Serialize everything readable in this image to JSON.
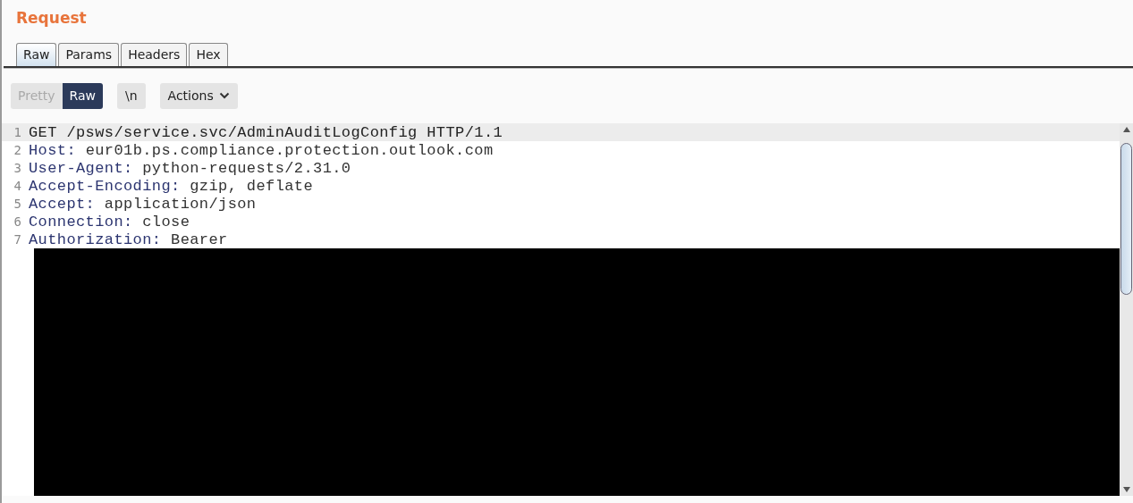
{
  "title": "Request",
  "tabs": [
    {
      "label": "Raw",
      "selected": true
    },
    {
      "label": "Params",
      "selected": false
    },
    {
      "label": "Headers",
      "selected": false
    },
    {
      "label": "Hex",
      "selected": false
    }
  ],
  "view_toggle": [
    {
      "label": "Pretty",
      "selected": false
    },
    {
      "label": "Raw",
      "selected": true
    }
  ],
  "newline_button": {
    "label": "\\n"
  },
  "actions_button": {
    "label": "Actions"
  },
  "editor": {
    "redacted": true,
    "lines": [
      {
        "number": "1",
        "kind": "request",
        "text": "GET /psws/service.svc/AdminAuditLogConfig HTTP/1.1",
        "highlighted": true
      },
      {
        "number": "2",
        "kind": "header",
        "name": "Host:",
        "value": "eur01b.ps.compliance.protection.outlook.com",
        "highlighted": false
      },
      {
        "number": "3",
        "kind": "header",
        "name": "User-Agent:",
        "value": "python-requests/2.31.0",
        "highlighted": false
      },
      {
        "number": "4",
        "kind": "header",
        "name": "Accept-Encoding:",
        "value": "gzip, deflate",
        "highlighted": false
      },
      {
        "number": "5",
        "kind": "header",
        "name": "Accept:",
        "value": "application/json",
        "highlighted": false
      },
      {
        "number": "6",
        "kind": "header",
        "name": "Connection:",
        "value": "close",
        "highlighted": false
      },
      {
        "number": "7",
        "kind": "header",
        "name": "Authorization:",
        "value": "Bearer",
        "highlighted": false
      }
    ]
  }
}
